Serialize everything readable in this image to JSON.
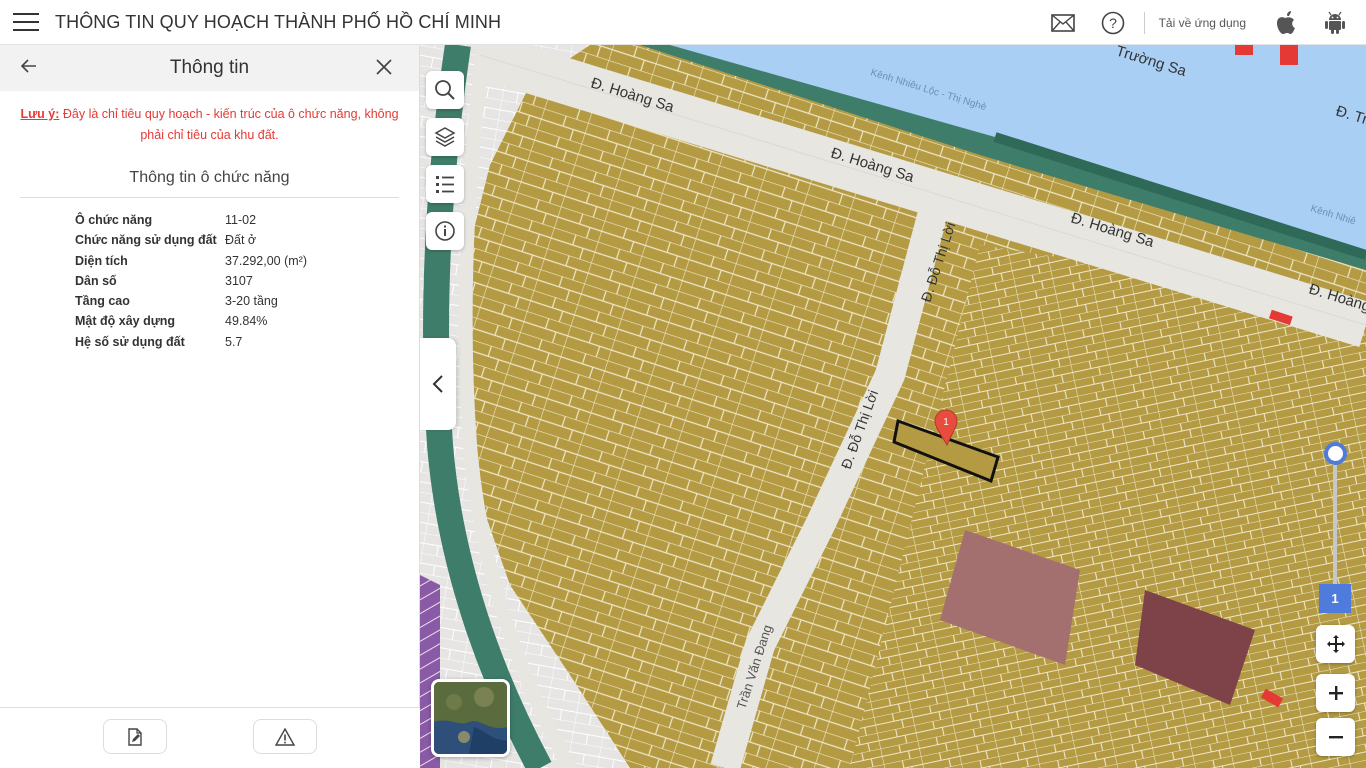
{
  "app": {
    "title": "THÔNG TIN QUY HOẠCH THÀNH PHỐ HỒ CHÍ MINH"
  },
  "header_actions": {
    "download_label": "Tải về ứng dụng",
    "icons": [
      "mail-icon",
      "help-icon",
      "apple-icon",
      "android-icon"
    ]
  },
  "panel": {
    "title": "Thông tin",
    "note_label": "Lưu ý:",
    "note_text": "Đây là chỉ tiêu quy hoạch - kiến trúc của ô chức năng, không phải chỉ tiêu của khu đất.",
    "section_title": "Thông tin ô chức năng",
    "rows": [
      {
        "key": "Ô chức năng",
        "value": "11-02"
      },
      {
        "key": "Chức năng sử dụng đất",
        "value": "Đất ở"
      },
      {
        "key": "Diện tích",
        "value": "37.292,00 (m²)"
      },
      {
        "key": "Dân số",
        "value": "3107"
      },
      {
        "key": "Tầng cao",
        "value": "3-20 tầng"
      },
      {
        "key": "Mật độ xây dựng",
        "value": "49.84%"
      },
      {
        "key": "Hệ số sử dụng đất",
        "value": "5.7"
      }
    ],
    "footer_buttons": [
      "document-edit-icon",
      "warning-icon"
    ]
  },
  "map": {
    "streets": [
      {
        "label": "Đ. Hoàng Sa"
      },
      {
        "label": "Đ. Hoàng Sa"
      },
      {
        "label": "Đ. Hoàng Sa"
      },
      {
        "label": "Đ. Hoàng"
      },
      {
        "label": "Đ. Đỗ Thị Lời"
      },
      {
        "label": "Đ. Đỗ Thị Lời"
      },
      {
        "label": "Trần Văn Đang"
      },
      {
        "label": "Trường Sa"
      },
      {
        "label": "Đ. Tr"
      },
      {
        "label": "Kênh Nhiêu Lộc - Thị Nghè"
      },
      {
        "label": "Kênh Nhiê"
      }
    ],
    "marker_label": "1",
    "zoom_level": "1",
    "colors": {
      "residential": "#b49b43",
      "road": "#e8e6e1",
      "canal": "#a9cff5",
      "canal_bank": "#3f7d6b",
      "highlight": "#a3706f",
      "dark_block": "#7d4349",
      "accent": "#4f7bdc"
    }
  }
}
